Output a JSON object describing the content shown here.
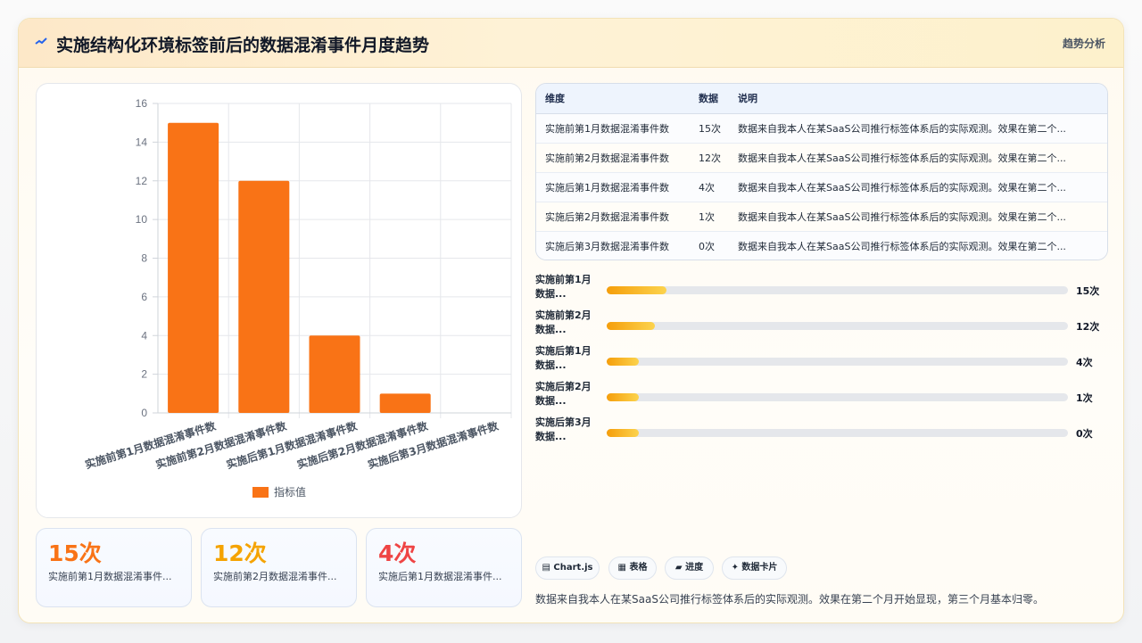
{
  "header": {
    "icon": "trend-icon",
    "title": "实施结构化环境标签前后的数据混淆事件月度趋势",
    "tag": "趋势分析"
  },
  "chart_data": {
    "type": "bar",
    "categories": [
      "实施前第1月数据混淆事件数",
      "实施前第2月数据混淆事件数",
      "实施后第1月数据混淆事件数",
      "实施后第2月数据混淆事件数",
      "实施后第3月数据混淆事件数"
    ],
    "series": [
      {
        "name": "指标值",
        "values": [
          15,
          12,
          4,
          1,
          0
        ],
        "color": "#f97316"
      }
    ],
    "ylim": [
      0,
      16
    ],
    "yticks": [
      0,
      2,
      4,
      6,
      8,
      10,
      12,
      14,
      16
    ],
    "grid": true,
    "legend": "bottom"
  },
  "kpis": [
    {
      "value": "15次",
      "label": "实施前第1月数据混淆事件...",
      "color": "#f97316"
    },
    {
      "value": "12次",
      "label": "实施前第2月数据混淆事件...",
      "color": "#f5a300"
    },
    {
      "value": "4次",
      "label": "实施后第1月数据混淆事件...",
      "color": "#ef4444"
    }
  ],
  "table": {
    "headers": [
      "维度",
      "数据",
      "说明"
    ],
    "rows": [
      [
        "实施前第1月数据混淆事件数",
        "15次",
        "数据来自我本人在某SaaS公司推行标签体系后的实际观测。效果在第二个..."
      ],
      [
        "实施前第2月数据混淆事件数",
        "12次",
        "数据来自我本人在某SaaS公司推行标签体系后的实际观测。效果在第二个..."
      ],
      [
        "实施后第1月数据混淆事件数",
        "4次",
        "数据来自我本人在某SaaS公司推行标签体系后的实际观测。效果在第二个..."
      ],
      [
        "实施后第2月数据混淆事件数",
        "1次",
        "数据来自我本人在某SaaS公司推行标签体系后的实际观测。效果在第二个..."
      ],
      [
        "实施后第3月数据混淆事件数",
        "0次",
        "数据来自我本人在某SaaS公司推行标签体系后的实际观测。效果在第二个..."
      ]
    ]
  },
  "progress": [
    {
      "label": "实施前第1月数据...",
      "value": "15次",
      "fraction": 0.13
    },
    {
      "label": "实施前第2月数据...",
      "value": "12次",
      "fraction": 0.105
    },
    {
      "label": "实施后第1月数据...",
      "value": "4次",
      "fraction": 0.07
    },
    {
      "label": "实施后第2月数据...",
      "value": "1次",
      "fraction": 0.07
    },
    {
      "label": "实施后第3月数据...",
      "value": "0次",
      "fraction": 0.07
    }
  ],
  "pills": [
    {
      "label": "▤ Chart.js"
    },
    {
      "label": "▦ 表格"
    },
    {
      "label": "▰ 进度"
    },
    {
      "label": "✦ 数据卡片"
    }
  ],
  "note": "数据来自我本人在某SaaS公司推行标签体系后的实际观测。效果在第二个月开始显现，第三个月基本归零。"
}
